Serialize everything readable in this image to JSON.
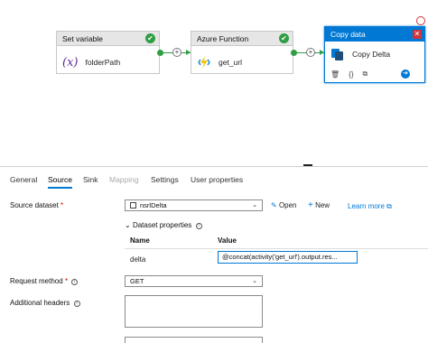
{
  "canvas": {
    "nodes": {
      "set_variable": {
        "title": "Set variable",
        "label": "folderPath",
        "icon": "variable-icon"
      },
      "azure_function": {
        "title": "Azure Function",
        "label": "get_url",
        "icon": "azure-function-icon"
      },
      "copy_data": {
        "title": "Copy Delta",
        "header": "Copy data",
        "label": "Copy Delta",
        "icon": "copy-data-icon"
      }
    },
    "add_symbol": "+",
    "check_symbol": "✔",
    "close_symbol": "✕",
    "tools": [
      "🗑",
      "{}",
      "⧉",
      "➔"
    ]
  },
  "tabs": [
    {
      "label": "General",
      "state": "normal"
    },
    {
      "label": "Source",
      "state": "active"
    },
    {
      "label": "Sink",
      "state": "normal"
    },
    {
      "label": "Mapping",
      "state": "disabled"
    },
    {
      "label": "Settings",
      "state": "normal"
    },
    {
      "label": "User properties",
      "state": "normal"
    }
  ],
  "form": {
    "source_dataset_label": "Source dataset",
    "required_mark": "*",
    "dataset_value": "nsrlDelta",
    "open_label": "Open",
    "new_label": "New",
    "learn_more_label": "Learn more",
    "dataset_properties_label": "Dataset properties",
    "table_headers": {
      "name": "Name",
      "value": "Value"
    },
    "table_row": {
      "name": "delta",
      "value": "@concat(activity('get_url').output.res..."
    },
    "request_method_label": "Request method",
    "request_method_value": "GET",
    "additional_headers_label": "Additional headers"
  },
  "colors": {
    "accent": "#0078d4",
    "success": "#2f9e44",
    "danger": "#d13438"
  }
}
